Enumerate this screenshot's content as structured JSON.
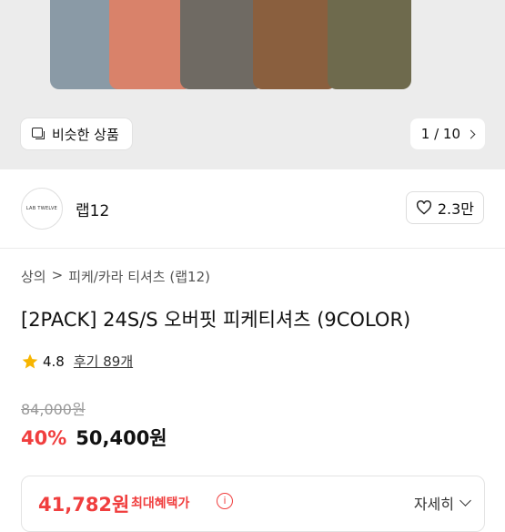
{
  "gallery": {
    "similar_label": "비슷한 상품",
    "pager_text": "1 / 10",
    "colors": [
      "#8a9aa6",
      "#d9826a",
      "#6f6a63",
      "#8a5f3e",
      "#6e6a4d"
    ]
  },
  "brand": {
    "logo_text": "LAB TWELVE",
    "name": "랩12",
    "likes": "2.3만"
  },
  "breadcrumb": {
    "level1": "상의",
    "separator": ">",
    "level2": "피케/카라 티셔츠 (랩12)"
  },
  "product": {
    "title": "[2PACK] 24S/S 오버핏 피케티셔츠 (9COLOR)",
    "rating": "4.8",
    "reviews": "후기 89개",
    "original_price": "84,000원",
    "discount": "40%",
    "price": "50,400원"
  },
  "benefit": {
    "price": "41,782원",
    "label": "최대혜택가",
    "info_icon": "i",
    "detail_label": "자세히"
  },
  "accent_color": "#f03e3e"
}
